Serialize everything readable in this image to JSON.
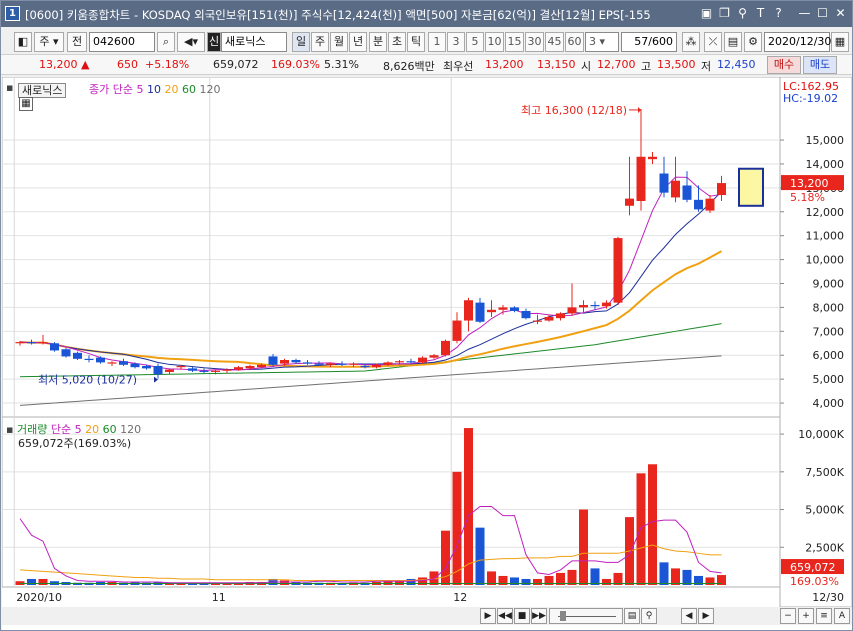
{
  "window": {
    "app_icon": "1",
    "title": "[0600] 키움종합차트 - KOSDAQ 외국인보유[151(천)] 주식수[12,424(천)] 액면[500] 자본금[62(억)] 결산[12월] EPS[-155"
  },
  "toolbar": {
    "ju": "주",
    "jeon": "전",
    "code": "042600",
    "sin": "신",
    "stock_name": "새로닉스",
    "periods": [
      "일",
      "주",
      "월",
      "년",
      "분",
      "초",
      "틱"
    ],
    "minutes": [
      "1",
      "3",
      "5",
      "10",
      "15",
      "30",
      "45",
      "60"
    ],
    "interval_value": "3",
    "page_count": "57/600",
    "date": "2020/12/30"
  },
  "quote": {
    "price": "13,200",
    "up_mark": "▲",
    "change": "650",
    "change_pct": "+5.18%",
    "volume": "659,072",
    "volume_ratio": "169.03%",
    "turnover": "5.31%",
    "amount": "8,626백만",
    "best_ask_label": "최우선",
    "best_ask": "13,200",
    "best_bid": "13,150",
    "open_label": "시",
    "open": "12,700",
    "high_label": "고",
    "high": "13,500",
    "low_label": "저",
    "low": "12,450",
    "buy_button": "매수",
    "sell_button": "매도"
  },
  "price_panel": {
    "stock_label": "새로닉스",
    "legend_prefix": "종가 단순",
    "ma": [
      "5",
      "10",
      "20",
      "60",
      "120"
    ],
    "lc": "LC:162.95",
    "hc": "HC:-19.02",
    "high_annotation": "최고 16,300 (12/18)",
    "low_annotation": "최저 5,020 (10/27)",
    "current_price_tag": "13,200",
    "current_pct_tag": "5.18%",
    "y_labels": [
      "15,000",
      "14,000",
      "13,000",
      "12,000",
      "11,000",
      "10,000",
      "9,000",
      "8,000",
      "7,000",
      "6,000",
      "5,000",
      "4,000"
    ]
  },
  "volume_panel": {
    "legend_title": "거래량",
    "legend_prefix": "단순",
    "ma": [
      "5",
      "20",
      "60",
      "120"
    ],
    "current_volume_text": "659,072주(169.03%)",
    "volume_tag": "659,072",
    "volume_pct_tag": "169.03%",
    "y_labels": [
      "10,000K",
      "7,500K",
      "5,000K",
      "2,500K"
    ]
  },
  "x_axis": {
    "labels": [
      "2020/10",
      "11",
      "12"
    ],
    "end_date": "12/30"
  },
  "colors": {
    "up": "#e8261e",
    "down": "#1a55d6",
    "ma5": "#c020c0",
    "ma10": "#1b2f9a",
    "ma20": "#f0a010",
    "ma60": "#1a8a2a",
    "ma120": "#707070"
  },
  "chart_data": {
    "type": "candlestick",
    "x_start": "2020/10/05",
    "x_end": "2020/12/30",
    "ylim": [
      3500,
      16800
    ],
    "candles": [
      [
        6500,
        6600,
        6400,
        6550
      ],
      [
        6550,
        6650,
        6450,
        6500
      ],
      [
        6500,
        6850,
        6450,
        6550
      ],
      [
        6500,
        6550,
        6150,
        6200
      ],
      [
        6250,
        6300,
        5900,
        5950
      ],
      [
        6100,
        6150,
        5800,
        5850
      ],
      [
        5850,
        6000,
        5700,
        5800
      ],
      [
        5900,
        5950,
        5650,
        5700
      ],
      [
        5650,
        5750,
        5550,
        5700
      ],
      [
        5750,
        5850,
        5550,
        5600
      ],
      [
        5650,
        5700,
        5450,
        5500
      ],
      [
        5550,
        5600,
        5400,
        5450
      ],
      [
        5550,
        5650,
        5020,
        5200
      ],
      [
        5300,
        5450,
        5200,
        5400
      ],
      [
        5500,
        5600,
        5400,
        5550
      ],
      [
        5450,
        5500,
        5300,
        5350
      ],
      [
        5350,
        5450,
        5250,
        5300
      ],
      [
        5300,
        5400,
        5200,
        5350
      ],
      [
        5350,
        5450,
        5250,
        5400
      ],
      [
        5400,
        5550,
        5350,
        5500
      ],
      [
        5450,
        5600,
        5400,
        5550
      ],
      [
        5500,
        5650,
        5450,
        5600
      ],
      [
        5950,
        6050,
        5550,
        5600
      ],
      [
        5650,
        5850,
        5550,
        5800
      ],
      [
        5800,
        5850,
        5650,
        5700
      ],
      [
        5700,
        5800,
        5600,
        5650
      ],
      [
        5650,
        5750,
        5550,
        5600
      ],
      [
        5600,
        5700,
        5500,
        5650
      ],
      [
        5650,
        5750,
        5550,
        5600
      ],
      [
        5600,
        5700,
        5500,
        5650
      ],
      [
        5550,
        5650,
        5450,
        5500
      ],
      [
        5500,
        5650,
        5450,
        5600
      ],
      [
        5600,
        5750,
        5550,
        5700
      ],
      [
        5700,
        5800,
        5600,
        5750
      ],
      [
        5750,
        5850,
        5650,
        5700
      ],
      [
        5700,
        5950,
        5650,
        5900
      ],
      [
        5900,
        6050,
        5850,
        6000
      ],
      [
        6000,
        6650,
        5950,
        6600
      ],
      [
        6600,
        7800,
        6500,
        7450
      ],
      [
        7450,
        8400,
        7000,
        8300
      ],
      [
        8200,
        8400,
        7350,
        7400
      ],
      [
        7800,
        8300,
        7600,
        7900
      ],
      [
        7900,
        8100,
        7700,
        8000
      ],
      [
        8000,
        8050,
        7800,
        7850
      ],
      [
        7850,
        7950,
        7500,
        7550
      ],
      [
        7400,
        7700,
        7300,
        7450
      ],
      [
        7450,
        7700,
        7400,
        7600
      ],
      [
        7550,
        7800,
        7450,
        7750
      ],
      [
        7750,
        9000,
        7650,
        8000
      ],
      [
        8000,
        8300,
        7800,
        8100
      ],
      [
        8100,
        8250,
        7900,
        8050
      ],
      [
        8050,
        8300,
        7950,
        8200
      ],
      [
        8200,
        10950,
        8100,
        10900
      ],
      [
        12250,
        14300,
        11850,
        12550
      ],
      [
        12450,
        16300,
        12050,
        14300
      ],
      [
        14200,
        14500,
        14000,
        14300
      ],
      [
        13600,
        14300,
        12600,
        12800
      ],
      [
        12600,
        14300,
        12400,
        13300
      ],
      [
        13100,
        13700,
        12400,
        12500
      ],
      [
        12500,
        13100,
        12000,
        12100
      ],
      [
        12050,
        12700,
        11950,
        12550
      ],
      [
        12700,
        13500,
        12450,
        13200
      ]
    ],
    "volumes": [
      25,
      40,
      40,
      25,
      20,
      15,
      15,
      20,
      20,
      15,
      20,
      15,
      20,
      10,
      10,
      10,
      10,
      10,
      10,
      15,
      20,
      20,
      40,
      30,
      20,
      15,
      15,
      15,
      10,
      15,
      15,
      20,
      25,
      30,
      40,
      50,
      90,
      360,
      750,
      1040,
      380,
      90,
      60,
      50,
      40,
      40,
      60,
      80,
      100,
      500,
      110,
      40,
      80,
      450,
      740,
      800,
      150,
      110,
      100,
      60,
      50,
      66
    ],
    "volume_ylim": [
      0,
      11000
    ],
    "volume_unit": "K",
    "volume_ma5": [
      440,
      330,
      290,
      110,
      60,
      30,
      25,
      25,
      25,
      20,
      20,
      20,
      20,
      15,
      15,
      15,
      15,
      15,
      15,
      15,
      15,
      15,
      20,
      20,
      20,
      20,
      25,
      25,
      20,
      20,
      20,
      25,
      25,
      25,
      25,
      30,
      40,
      110,
      260,
      460,
      520,
      520,
      460,
      460,
      200,
      80,
      70,
      100,
      160,
      160,
      160,
      150,
      150,
      200,
      380,
      420,
      430,
      430,
      350,
      150,
      90,
      80
    ],
    "volume_ma20": [
      100,
      95,
      90,
      85,
      80,
      75,
      70,
      65,
      60,
      55,
      50,
      50,
      45,
      45,
      40,
      40,
      40,
      35,
      35,
      35,
      35,
      35,
      35,
      35,
      30,
      30,
      30,
      30,
      30,
      30,
      30,
      30,
      30,
      30,
      30,
      35,
      40,
      55,
      90,
      140,
      165,
      170,
      175,
      175,
      180,
      180,
      180,
      190,
      190,
      210,
      210,
      210,
      210,
      225,
      245,
      265,
      240,
      225,
      220,
      210,
      200,
      200
    ],
    "volume_ma60": [
      10,
      10,
      10,
      10,
      10,
      10,
      10,
      10,
      10,
      10,
      10,
      10,
      10,
      10,
      10,
      10,
      10,
      10,
      10,
      10,
      10,
      10,
      10,
      10,
      10,
      10,
      10,
      10,
      10,
      10,
      10,
      10,
      10,
      10,
      10,
      10,
      10,
      10,
      10,
      10,
      10,
      10,
      10,
      10,
      10,
      10,
      10,
      10,
      10,
      10,
      10,
      10,
      10,
      10,
      10,
      10,
      10,
      10,
      10,
      10,
      10,
      10
    ]
  }
}
